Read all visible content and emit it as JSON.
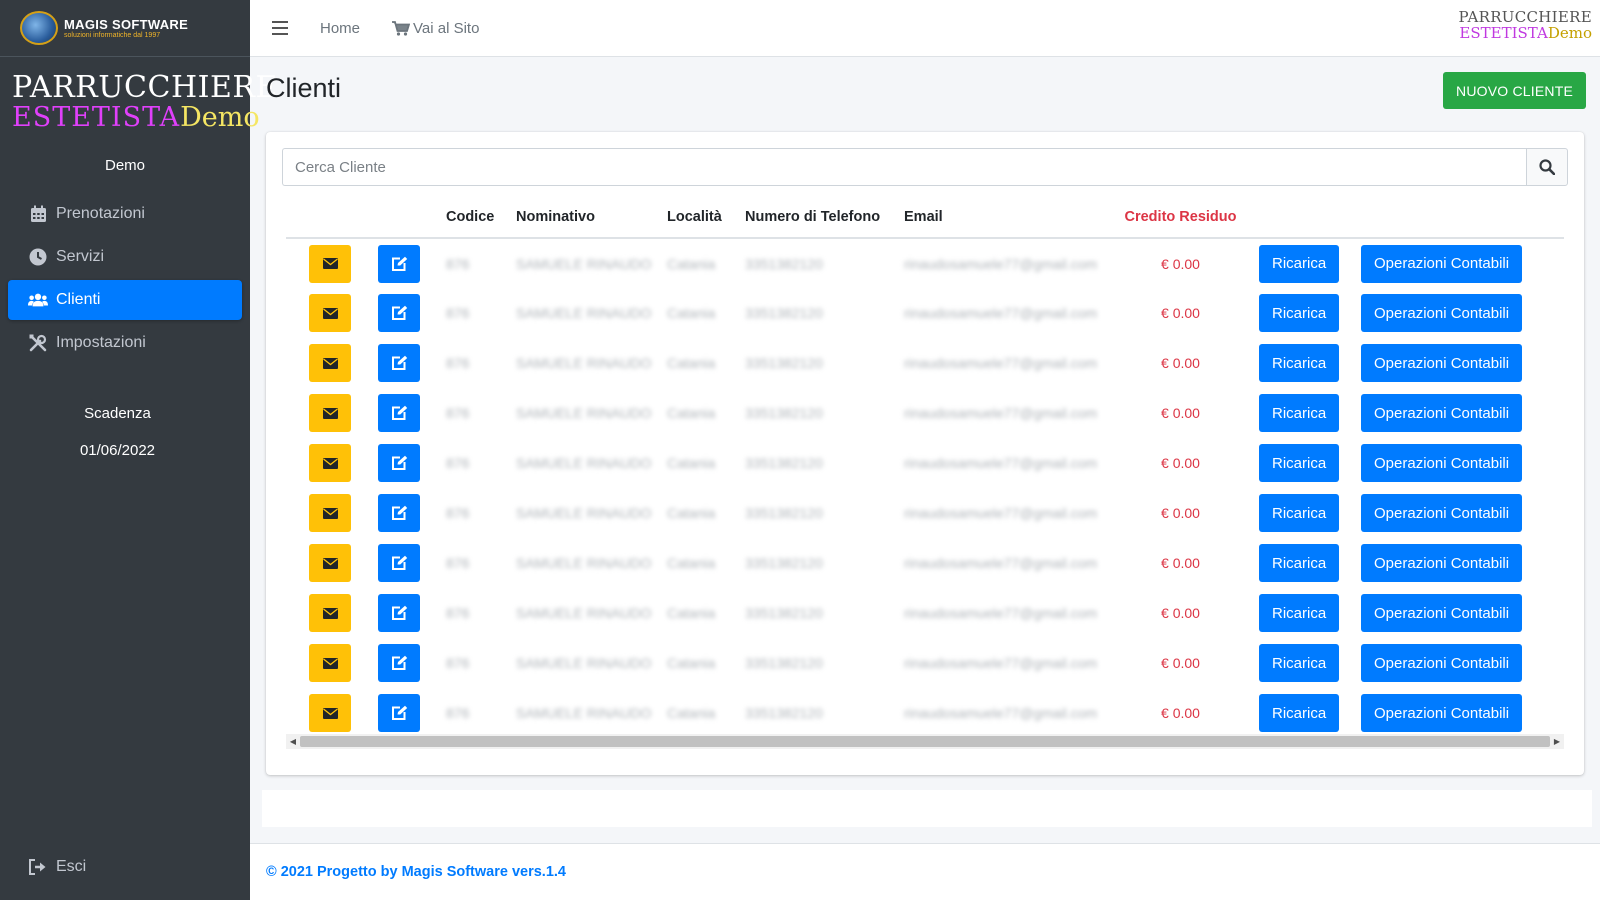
{
  "sidebar": {
    "brand_name": "MAGIS SOFTWARE",
    "brand_sub": "soluzioni informatiche dal 1997",
    "logo_line1": "PARRUCCHIERE",
    "logo_line2a": "ESTETISTA",
    "logo_line2b": "Demo",
    "user": "Demo",
    "items": [
      {
        "label": "Prenotazioni",
        "icon": "calendar-icon"
      },
      {
        "label": "Servizi",
        "icon": "clock-icon"
      },
      {
        "label": "Clienti",
        "icon": "users-icon",
        "active": true
      },
      {
        "label": "Impostazioni",
        "icon": "tools-icon"
      }
    ],
    "expiry_label": "Scadenza",
    "expiry_date": "01/06/2022",
    "logout": "Esci"
  },
  "topbar": {
    "home": "Home",
    "site": "Vai al Sito",
    "logo_line1": "PARRUCCHIERE",
    "logo_line2a": "ESTETISTA",
    "logo_line2b": "Demo"
  },
  "page": {
    "title": "Clienti",
    "new_button": "NUOVO CLIENTE",
    "search_placeholder": "Cerca Cliente"
  },
  "table": {
    "headers": [
      "Codice",
      "Nominativo",
      "Località",
      "Numero di Telefono",
      "Email",
      "Credito Residuo"
    ],
    "recharge_label": "Ricarica",
    "operations_label": "Operazioni Contabili",
    "rows": [
      {
        "codice": "876",
        "nominativo": "SAMUELE RINAUDO",
        "localita": "Catania",
        "telefono": "3351382120",
        "email": "rinaudosamuele77@gmail.com",
        "credito": "€ 0.00"
      },
      {
        "codice": "876",
        "nominativo": "SAMUELE RINAUDO",
        "localita": "Catania",
        "telefono": "3351382120",
        "email": "rinaudosamuele77@gmail.com",
        "credito": "€ 0.00"
      },
      {
        "codice": "876",
        "nominativo": "SAMUELE RINAUDO",
        "localita": "Catania",
        "telefono": "3351382120",
        "email": "rinaudosamuele77@gmail.com",
        "credito": "€ 0.00"
      },
      {
        "codice": "876",
        "nominativo": "SAMUELE RINAUDO",
        "localita": "Catania",
        "telefono": "3351382120",
        "email": "rinaudosamuele77@gmail.com",
        "credito": "€ 0.00"
      },
      {
        "codice": "876",
        "nominativo": "SAMUELE RINAUDO",
        "localita": "Catania",
        "telefono": "3351382120",
        "email": "rinaudosamuele77@gmail.com",
        "credito": "€ 0.00"
      },
      {
        "codice": "876",
        "nominativo": "SAMUELE RINAUDO",
        "localita": "Catania",
        "telefono": "3351382120",
        "email": "rinaudosamuele77@gmail.com",
        "credito": "€ 0.00"
      },
      {
        "codice": "876",
        "nominativo": "SAMUELE RINAUDO",
        "localita": "Catania",
        "telefono": "3351382120",
        "email": "rinaudosamuele77@gmail.com",
        "credito": "€ 0.00"
      },
      {
        "codice": "876",
        "nominativo": "SAMUELE RINAUDO",
        "localita": "Catania",
        "telefono": "3351382120",
        "email": "rinaudosamuele77@gmail.com",
        "credito": "€ 0.00"
      },
      {
        "codice": "876",
        "nominativo": "SAMUELE RINAUDO",
        "localita": "Catania",
        "telefono": "3351382120",
        "email": "rinaudosamuele77@gmail.com",
        "credito": "€ 0.00"
      },
      {
        "codice": "876",
        "nominativo": "SAMUELE RINAUDO",
        "localita": "Catania",
        "telefono": "3351382120",
        "email": "rinaudosamuele77@gmail.com",
        "credito": "€ 0.00"
      }
    ]
  },
  "footer": {
    "text": "© 2021 Progetto by Magis Software vers.1.4"
  },
  "colors": {
    "sidebar_bg": "#343a40",
    "primary": "#007bff",
    "success": "#28a745",
    "warning": "#ffc107",
    "danger": "#dc3545"
  }
}
